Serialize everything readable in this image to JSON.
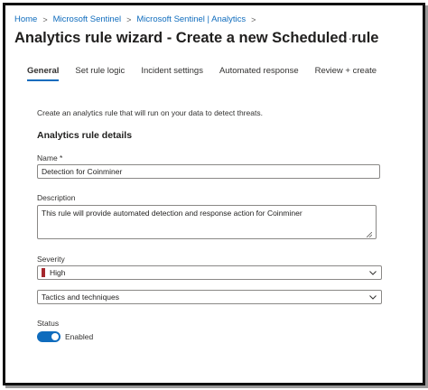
{
  "breadcrumb": [
    {
      "label": "Home"
    },
    {
      "label": "Microsoft Sentinel"
    },
    {
      "label": "Microsoft Sentinel | Analytics"
    }
  ],
  "breadcrumb_separator": ">",
  "page": {
    "title": "Analytics rule wizard - Create a new Scheduled rule",
    "more_label": "···"
  },
  "tabs": [
    {
      "label": "General",
      "active": true
    },
    {
      "label": "Set rule logic",
      "active": false
    },
    {
      "label": "Incident settings",
      "active": false
    },
    {
      "label": "Automated response",
      "active": false
    },
    {
      "label": "Review + create",
      "active": false
    }
  ],
  "general": {
    "intro": "Create an analytics rule that will run on your data to detect threats.",
    "section_title": "Analytics rule details",
    "name": {
      "label": "Name *",
      "value": "Detection for Coinminer"
    },
    "description": {
      "label": "Description",
      "value": "This rule will provide automated detection and response action for Coinminer"
    },
    "severity": {
      "label": "Severity",
      "value": "High",
      "indicator_color": "#a4262c"
    },
    "tactics": {
      "value": "Tactics and techniques"
    },
    "status": {
      "label": "Status",
      "value": "Enabled",
      "enabled": true,
      "toggle_color": "#0f6cbd"
    }
  },
  "colors": {
    "link": "#0f6cbd",
    "accent": "#0f6cbd"
  }
}
